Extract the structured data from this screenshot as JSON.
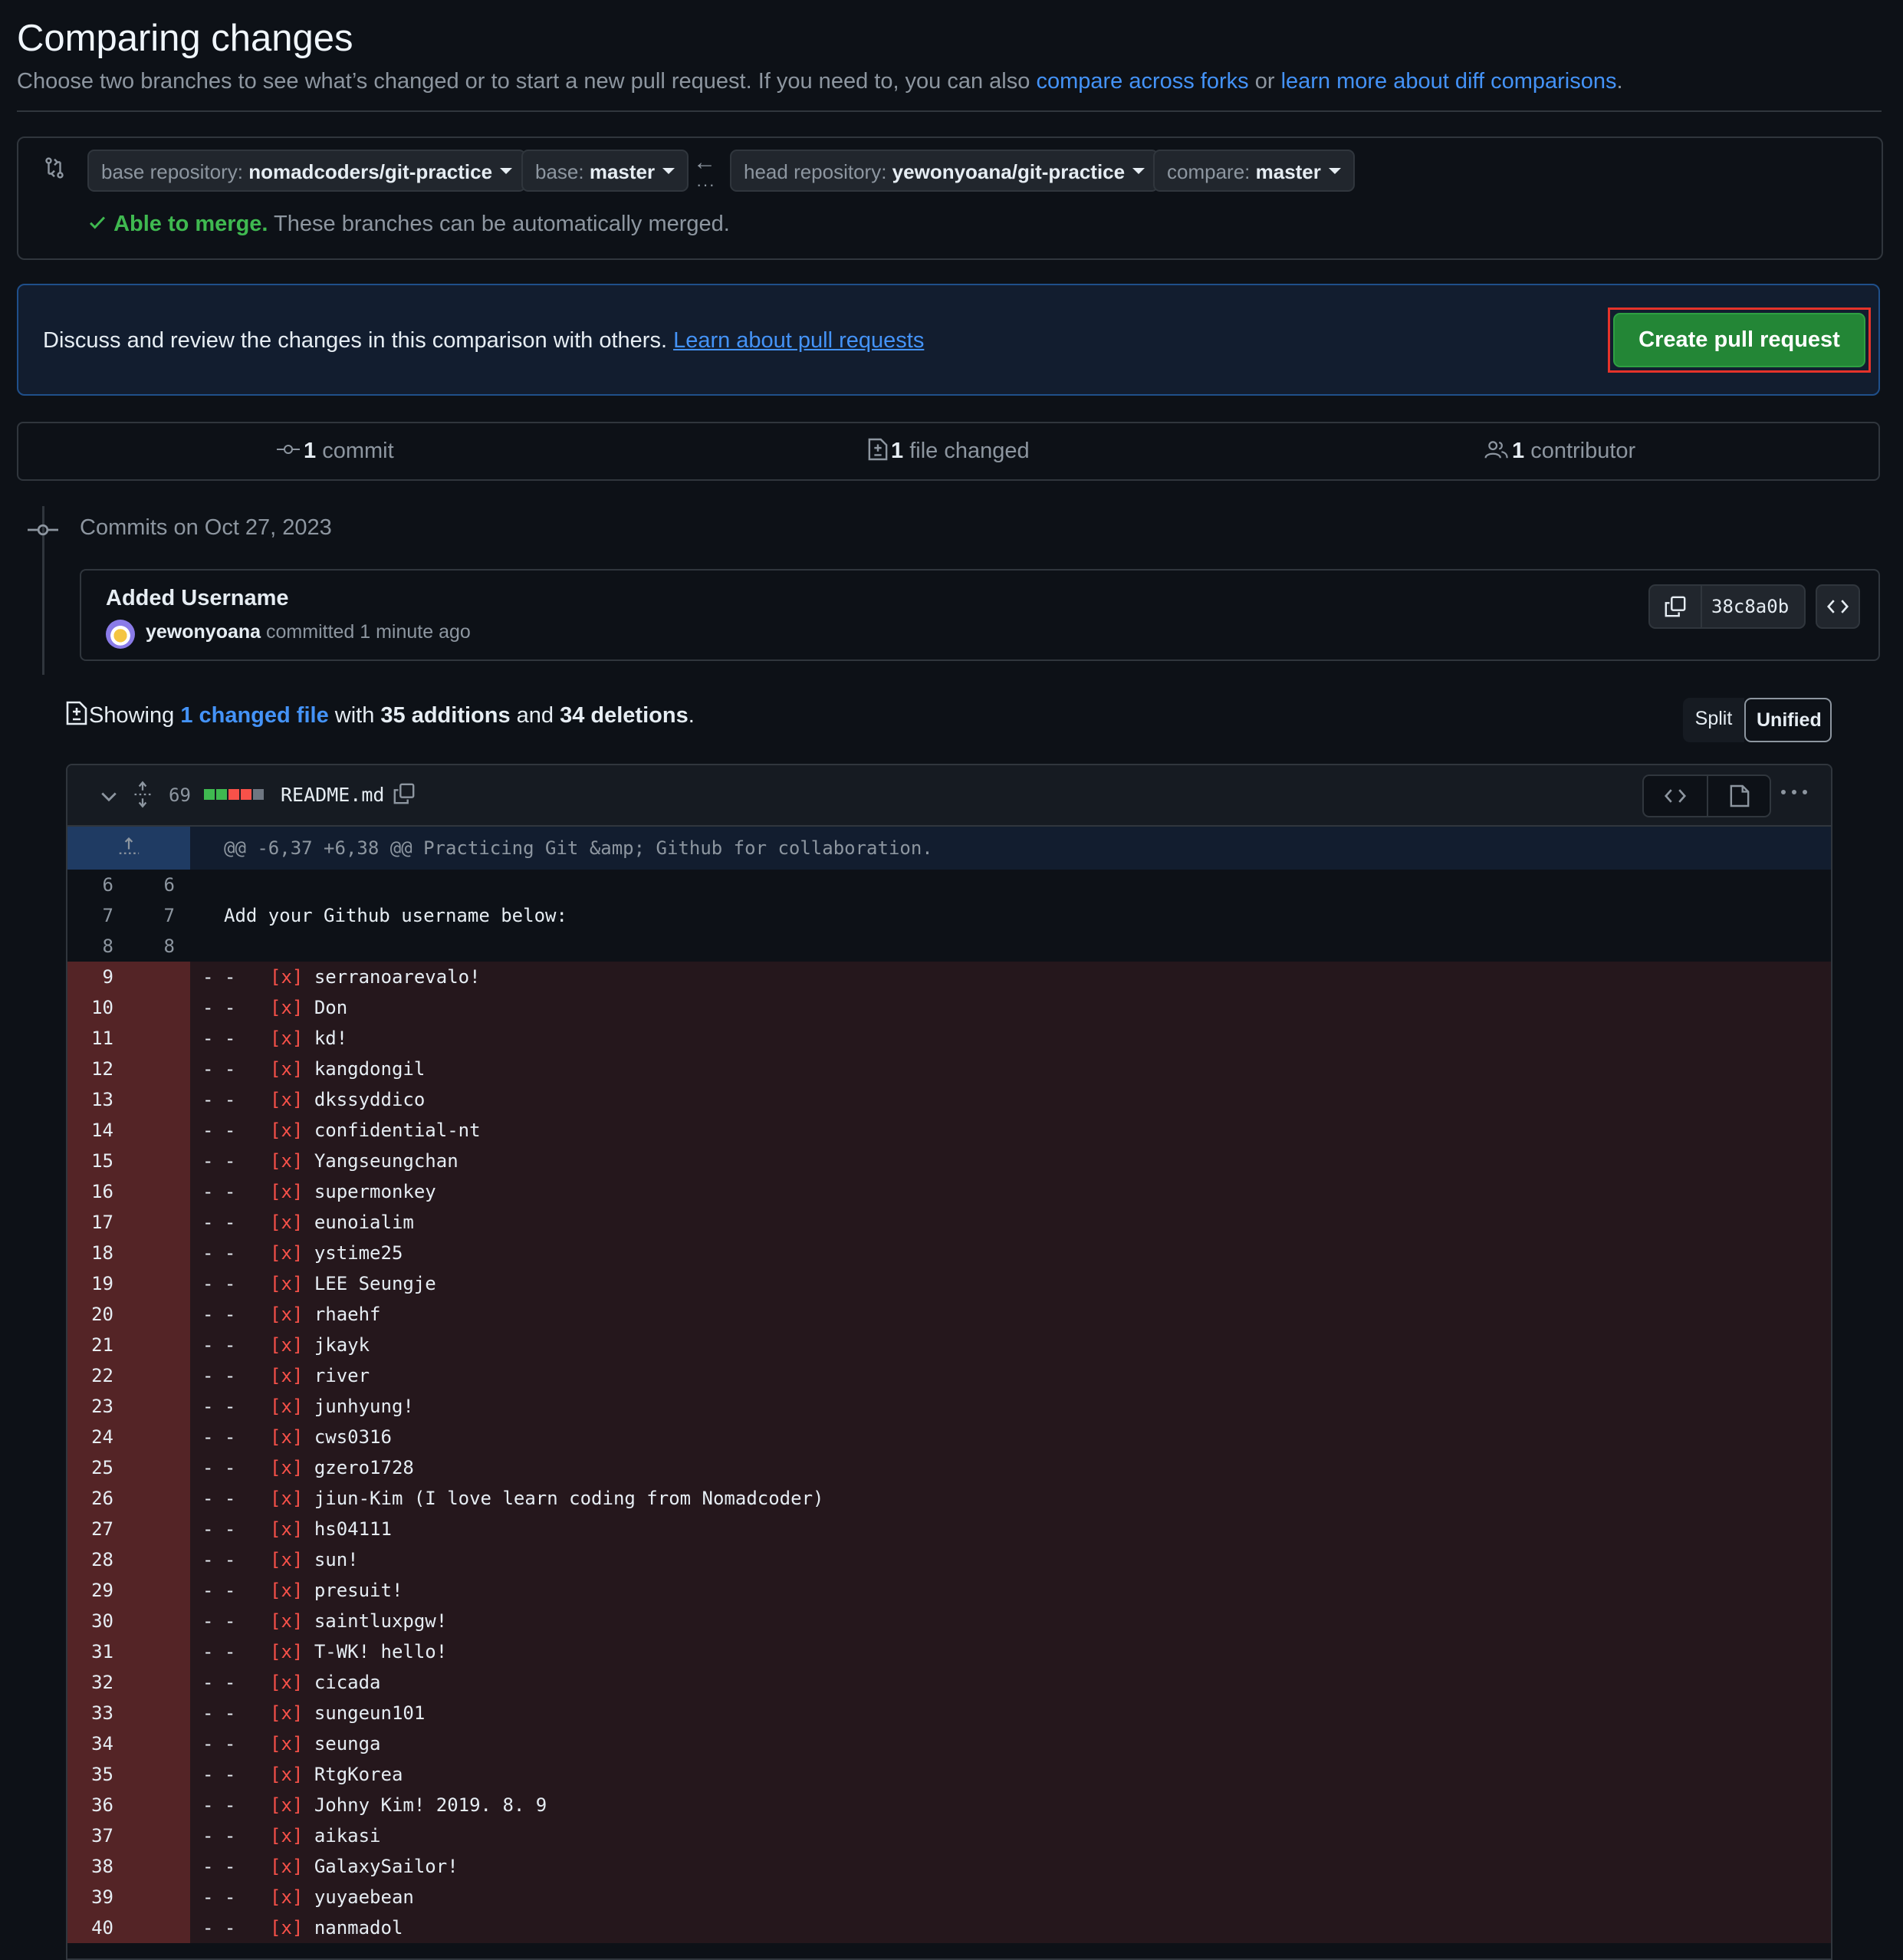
{
  "header": {
    "title": "Comparing changes",
    "subtitle_prefix": "Choose two branches to see what’s changed or to start a new pull request. If you need to, you can also ",
    "link_forks": "compare across forks",
    "subtitle_or": " or ",
    "link_learn_diff": "learn more about diff comparisons",
    "subtitle_suffix": "."
  },
  "compare": {
    "base_repo_label": "base repository: ",
    "base_repo_value": "nomadcoders/git-practice",
    "base_label": "base: ",
    "base_value": "master",
    "head_repo_label": "head repository: ",
    "head_repo_value": "yewonyoana/git-practice",
    "compare_label": "compare: ",
    "compare_value": "master",
    "merge_status": "Able to merge.",
    "merge_detail": " These branches can be automatically merged."
  },
  "banner": {
    "text": "Discuss and review the changes in this comparison with others. ",
    "link": "Learn about pull requests",
    "button": "Create pull request"
  },
  "stats": {
    "commits_count": "1",
    "commits_label": " commit",
    "files_count": "1",
    "files_label": " file changed",
    "contributors_count": "1",
    "contributors_label": " contributor"
  },
  "commits": {
    "date_heading": "Commits on Oct 27, 2023",
    "commit_title": "Added Username",
    "author": "yewonyoana",
    "meta": " committed 1 minute ago",
    "sha": "38c8a0b"
  },
  "summary": {
    "prefix": "Showing ",
    "files_link": "1 changed file",
    "with": " with ",
    "additions": "35 additions",
    "and": " and ",
    "deletions": "34 deletions",
    "suffix": ".",
    "view_split": "Split",
    "view_unified": "Unified"
  },
  "diff": {
    "change_count": "69",
    "filename": "README.md",
    "diffstat_colors": [
      "#3fb950",
      "#3fb950",
      "#f85149",
      "#f85149",
      "#6e7681"
    ],
    "hunk_header": "@@ -6,37 +6,38 @@ Practicing Git &amp; Github for collaboration.",
    "context_rows": [
      {
        "old": "6",
        "new": "6",
        "text": ""
      },
      {
        "old": "7",
        "new": "7",
        "text": "Add your Github username below:"
      },
      {
        "old": "8",
        "new": "8",
        "text": ""
      }
    ],
    "deleted_rows": [
      {
        "old": "9",
        "name": "serranoarevalo!"
      },
      {
        "old": "10",
        "name": "Don"
      },
      {
        "old": "11",
        "name": "kd!"
      },
      {
        "old": "12",
        "name": "kangdongil"
      },
      {
        "old": "13",
        "name": "dkssyddico"
      },
      {
        "old": "14",
        "name": "confidential-nt"
      },
      {
        "old": "15",
        "name": "Yangseungchan"
      },
      {
        "old": "16",
        "name": "supermonkey"
      },
      {
        "old": "17",
        "name": "eunoialim"
      },
      {
        "old": "18",
        "name": "ystime25"
      },
      {
        "old": "19",
        "name": "LEE Seungje"
      },
      {
        "old": "20",
        "name": "rhaehf"
      },
      {
        "old": "21",
        "name": "jkayk"
      },
      {
        "old": "22",
        "name": "river"
      },
      {
        "old": "23",
        "name": "junhyung!"
      },
      {
        "old": "24",
        "name": "cws0316"
      },
      {
        "old": "25",
        "name": "gzero1728"
      },
      {
        "old": "26",
        "name": "jiun-Kim (I love learn coding from Nomadcoder)"
      },
      {
        "old": "27",
        "name": "hs04111"
      },
      {
        "old": "28",
        "name": "sun!"
      },
      {
        "old": "29",
        "name": "presuit!"
      },
      {
        "old": "30",
        "name": "saintluxpgw!"
      },
      {
        "old": "31",
        "name": "T-WK! hello!"
      },
      {
        "old": "32",
        "name": "cicada"
      },
      {
        "old": "33",
        "name": "sungeun101"
      },
      {
        "old": "34",
        "name": "seunga"
      },
      {
        "old": "35",
        "name": "RtgKorea"
      },
      {
        "old": "36",
        "name": "Johny Kim! 2019. 8. 9"
      },
      {
        "old": "37",
        "name": "aikasi"
      },
      {
        "old": "38",
        "name": "GalaxySailor!"
      },
      {
        "old": "39",
        "name": "yuyaebean"
      },
      {
        "old": "40",
        "name": "nanmadol"
      }
    ],
    "del_sign": "- -",
    "check_mark": "[x]"
  }
}
